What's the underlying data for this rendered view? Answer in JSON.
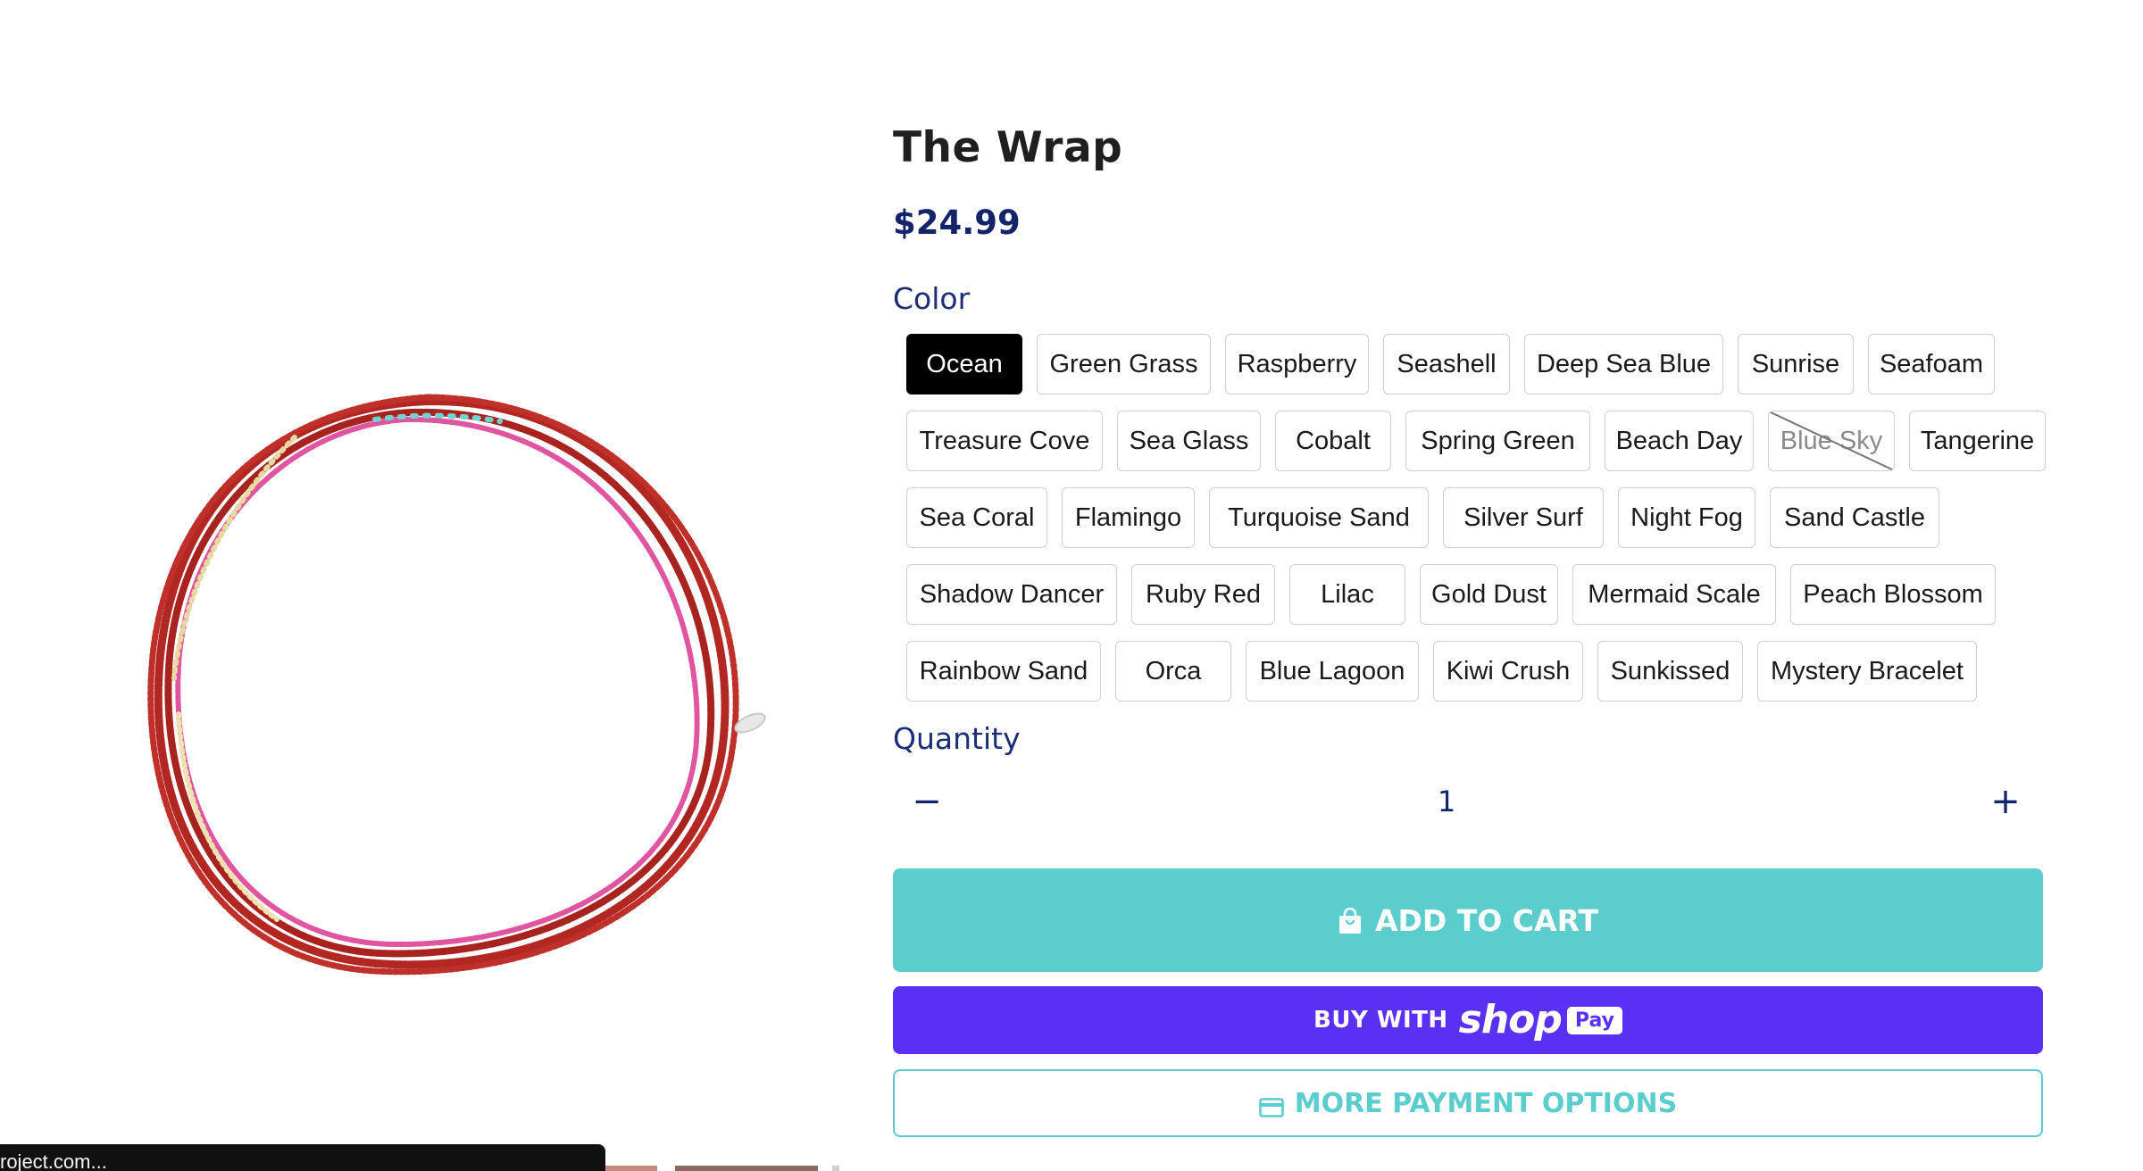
{
  "product": {
    "title": "The Wrap",
    "price": "$24.99",
    "image_alt": "Red beaded wrap bracelet"
  },
  "options": {
    "color_label": "Color",
    "colors": [
      {
        "label": "Ocean",
        "selected": true,
        "available": true
      },
      {
        "label": "Green Grass",
        "selected": false,
        "available": true
      },
      {
        "label": "Raspberry",
        "selected": false,
        "available": true
      },
      {
        "label": "Seashell",
        "selected": false,
        "available": true
      },
      {
        "label": "Deep Sea Blue",
        "selected": false,
        "available": true
      },
      {
        "label": "Sunrise",
        "selected": false,
        "available": true
      },
      {
        "label": "Seafoam",
        "selected": false,
        "available": true
      },
      {
        "label": "Treasure Cove",
        "selected": false,
        "available": true
      },
      {
        "label": "Sea Glass",
        "selected": false,
        "available": true
      },
      {
        "label": "Cobalt",
        "selected": false,
        "available": true
      },
      {
        "label": "Spring Green",
        "selected": false,
        "available": true
      },
      {
        "label": "Beach Day",
        "selected": false,
        "available": true
      },
      {
        "label": "Blue Sky",
        "selected": false,
        "available": false
      },
      {
        "label": "Tangerine",
        "selected": false,
        "available": true
      },
      {
        "label": "Sea Coral",
        "selected": false,
        "available": true
      },
      {
        "label": "Flamingo",
        "selected": false,
        "available": true
      },
      {
        "label": "Turquoise Sand",
        "selected": false,
        "available": true
      },
      {
        "label": "Silver Surf",
        "selected": false,
        "available": true
      },
      {
        "label": "Night Fog",
        "selected": false,
        "available": true
      },
      {
        "label": "Sand Castle",
        "selected": false,
        "available": true
      },
      {
        "label": "Shadow Dancer",
        "selected": false,
        "available": true
      },
      {
        "label": "Ruby Red",
        "selected": false,
        "available": true
      },
      {
        "label": "Lilac",
        "selected": false,
        "available": true
      },
      {
        "label": "Gold Dust",
        "selected": false,
        "available": true
      },
      {
        "label": "Mermaid Scale",
        "selected": false,
        "available": true
      },
      {
        "label": "Peach Blossom",
        "selected": false,
        "available": true
      },
      {
        "label": "Rainbow Sand",
        "selected": false,
        "available": true
      },
      {
        "label": "Orca",
        "selected": false,
        "available": true
      },
      {
        "label": "Blue Lagoon",
        "selected": false,
        "available": true
      },
      {
        "label": "Kiwi Crush",
        "selected": false,
        "available": true
      },
      {
        "label": "Sunkissed",
        "selected": false,
        "available": true
      },
      {
        "label": "Mystery Bracelet",
        "selected": false,
        "available": true
      }
    ]
  },
  "quantity": {
    "label": "Quantity",
    "value": "1",
    "minus_symbol": "−",
    "plus_symbol": "+"
  },
  "buttons": {
    "add_to_cart": "ADD TO CART",
    "buy_with": "BUY WITH",
    "shop_word": "shop",
    "pay_badge": "Pay",
    "more_payment_options": "MORE PAYMENT OPTIONS"
  },
  "status_bar": {
    "link_text": "roject.com..."
  },
  "colors": {
    "price": "#13246b",
    "label": "#1b2c78",
    "add_to_cart_bg": "#5ccdcd",
    "shop_pay_bg": "#5a31f4",
    "selected_swatch_bg": "#000000",
    "bead_red": "#b42a26",
    "bead_pink": "#e0559f"
  },
  "icons": {
    "add_to_cart": "shopping-bag-icon",
    "more_payment": "credit-card-icon"
  }
}
